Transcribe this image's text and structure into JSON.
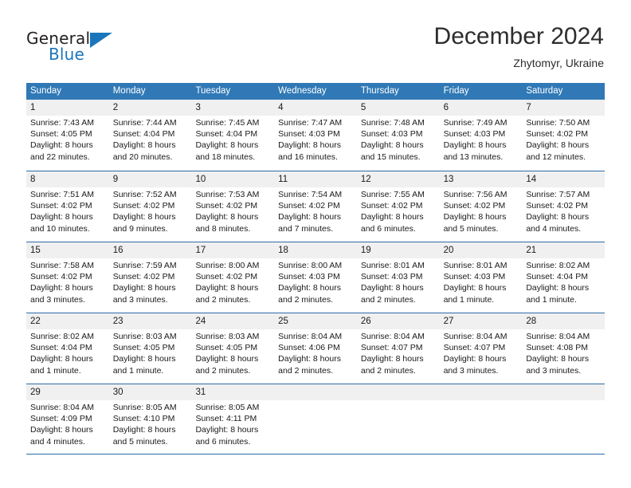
{
  "brand": {
    "name_part1": "General",
    "name_part2": "Blue",
    "flag_icon": "triangle-flag-icon"
  },
  "header": {
    "title": "December 2024",
    "subtitle": "Zhytomyr, Ukraine"
  },
  "theme": {
    "header_blue": "#3079b6",
    "rule_blue": "#2c6ca6",
    "band_gray": "#f0f0f0",
    "brand_blue": "#1b75bb",
    "text": "#1a1a1a"
  },
  "weekdays": [
    "Sunday",
    "Monday",
    "Tuesday",
    "Wednesday",
    "Thursday",
    "Friday",
    "Saturday"
  ],
  "weeks": [
    [
      {
        "day": "1",
        "lines": [
          "Sunrise: 7:43 AM",
          "Sunset: 4:05 PM",
          "Daylight: 8 hours",
          "and 22 minutes."
        ]
      },
      {
        "day": "2",
        "lines": [
          "Sunrise: 7:44 AM",
          "Sunset: 4:04 PM",
          "Daylight: 8 hours",
          "and 20 minutes."
        ]
      },
      {
        "day": "3",
        "lines": [
          "Sunrise: 7:45 AM",
          "Sunset: 4:04 PM",
          "Daylight: 8 hours",
          "and 18 minutes."
        ]
      },
      {
        "day": "4",
        "lines": [
          "Sunrise: 7:47 AM",
          "Sunset: 4:03 PM",
          "Daylight: 8 hours",
          "and 16 minutes."
        ]
      },
      {
        "day": "5",
        "lines": [
          "Sunrise: 7:48 AM",
          "Sunset: 4:03 PM",
          "Daylight: 8 hours",
          "and 15 minutes."
        ]
      },
      {
        "day": "6",
        "lines": [
          "Sunrise: 7:49 AM",
          "Sunset: 4:03 PM",
          "Daylight: 8 hours",
          "and 13 minutes."
        ]
      },
      {
        "day": "7",
        "lines": [
          "Sunrise: 7:50 AM",
          "Sunset: 4:02 PM",
          "Daylight: 8 hours",
          "and 12 minutes."
        ]
      }
    ],
    [
      {
        "day": "8",
        "lines": [
          "Sunrise: 7:51 AM",
          "Sunset: 4:02 PM",
          "Daylight: 8 hours",
          "and 10 minutes."
        ]
      },
      {
        "day": "9",
        "lines": [
          "Sunrise: 7:52 AM",
          "Sunset: 4:02 PM",
          "Daylight: 8 hours",
          "and 9 minutes."
        ]
      },
      {
        "day": "10",
        "lines": [
          "Sunrise: 7:53 AM",
          "Sunset: 4:02 PM",
          "Daylight: 8 hours",
          "and 8 minutes."
        ]
      },
      {
        "day": "11",
        "lines": [
          "Sunrise: 7:54 AM",
          "Sunset: 4:02 PM",
          "Daylight: 8 hours",
          "and 7 minutes."
        ]
      },
      {
        "day": "12",
        "lines": [
          "Sunrise: 7:55 AM",
          "Sunset: 4:02 PM",
          "Daylight: 8 hours",
          "and 6 minutes."
        ]
      },
      {
        "day": "13",
        "lines": [
          "Sunrise: 7:56 AM",
          "Sunset: 4:02 PM",
          "Daylight: 8 hours",
          "and 5 minutes."
        ]
      },
      {
        "day": "14",
        "lines": [
          "Sunrise: 7:57 AM",
          "Sunset: 4:02 PM",
          "Daylight: 8 hours",
          "and 4 minutes."
        ]
      }
    ],
    [
      {
        "day": "15",
        "lines": [
          "Sunrise: 7:58 AM",
          "Sunset: 4:02 PM",
          "Daylight: 8 hours",
          "and 3 minutes."
        ]
      },
      {
        "day": "16",
        "lines": [
          "Sunrise: 7:59 AM",
          "Sunset: 4:02 PM",
          "Daylight: 8 hours",
          "and 3 minutes."
        ]
      },
      {
        "day": "17",
        "lines": [
          "Sunrise: 8:00 AM",
          "Sunset: 4:02 PM",
          "Daylight: 8 hours",
          "and 2 minutes."
        ]
      },
      {
        "day": "18",
        "lines": [
          "Sunrise: 8:00 AM",
          "Sunset: 4:03 PM",
          "Daylight: 8 hours",
          "and 2 minutes."
        ]
      },
      {
        "day": "19",
        "lines": [
          "Sunrise: 8:01 AM",
          "Sunset: 4:03 PM",
          "Daylight: 8 hours",
          "and 2 minutes."
        ]
      },
      {
        "day": "20",
        "lines": [
          "Sunrise: 8:01 AM",
          "Sunset: 4:03 PM",
          "Daylight: 8 hours",
          "and 1 minute."
        ]
      },
      {
        "day": "21",
        "lines": [
          "Sunrise: 8:02 AM",
          "Sunset: 4:04 PM",
          "Daylight: 8 hours",
          "and 1 minute."
        ]
      }
    ],
    [
      {
        "day": "22",
        "lines": [
          "Sunrise: 8:02 AM",
          "Sunset: 4:04 PM",
          "Daylight: 8 hours",
          "and 1 minute."
        ]
      },
      {
        "day": "23",
        "lines": [
          "Sunrise: 8:03 AM",
          "Sunset: 4:05 PM",
          "Daylight: 8 hours",
          "and 1 minute."
        ]
      },
      {
        "day": "24",
        "lines": [
          "Sunrise: 8:03 AM",
          "Sunset: 4:05 PM",
          "Daylight: 8 hours",
          "and 2 minutes."
        ]
      },
      {
        "day": "25",
        "lines": [
          "Sunrise: 8:04 AM",
          "Sunset: 4:06 PM",
          "Daylight: 8 hours",
          "and 2 minutes."
        ]
      },
      {
        "day": "26",
        "lines": [
          "Sunrise: 8:04 AM",
          "Sunset: 4:07 PM",
          "Daylight: 8 hours",
          "and 2 minutes."
        ]
      },
      {
        "day": "27",
        "lines": [
          "Sunrise: 8:04 AM",
          "Sunset: 4:07 PM",
          "Daylight: 8 hours",
          "and 3 minutes."
        ]
      },
      {
        "day": "28",
        "lines": [
          "Sunrise: 8:04 AM",
          "Sunset: 4:08 PM",
          "Daylight: 8 hours",
          "and 3 minutes."
        ]
      }
    ],
    [
      {
        "day": "29",
        "lines": [
          "Sunrise: 8:04 AM",
          "Sunset: 4:09 PM",
          "Daylight: 8 hours",
          "and 4 minutes."
        ]
      },
      {
        "day": "30",
        "lines": [
          "Sunrise: 8:05 AM",
          "Sunset: 4:10 PM",
          "Daylight: 8 hours",
          "and 5 minutes."
        ]
      },
      {
        "day": "31",
        "lines": [
          "Sunrise: 8:05 AM",
          "Sunset: 4:11 PM",
          "Daylight: 8 hours",
          "and 6 minutes."
        ]
      },
      {
        "day": "",
        "lines": []
      },
      {
        "day": "",
        "lines": []
      },
      {
        "day": "",
        "lines": []
      },
      {
        "day": "",
        "lines": []
      }
    ]
  ]
}
